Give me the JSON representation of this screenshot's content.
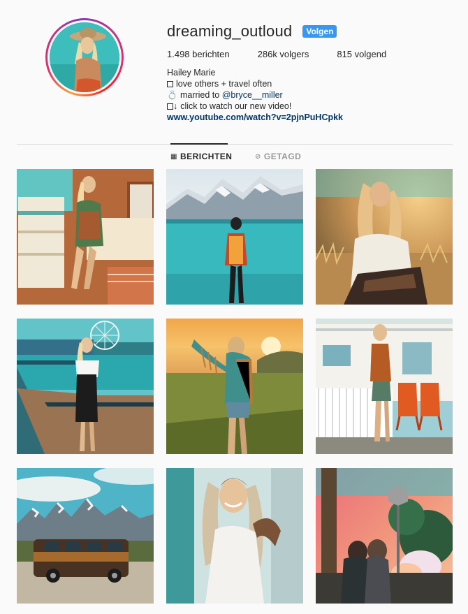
{
  "profile": {
    "username": "dreaming_outloud",
    "follow_label": "Volgen",
    "stats": {
      "posts": "1.498 berichten",
      "followers": "286k volgers",
      "following": "815 volgend"
    },
    "bio": {
      "name": "Hailey Marie",
      "line1": "love others + travel often",
      "line2_prefix": "married to ",
      "line2_mention": "@bryce__miller",
      "line3": "click to watch our new video!",
      "link": "www.youtube.com/watch?v=2pjnPuHCpkk"
    }
  },
  "tabs": {
    "posts": "BERICHTEN",
    "tagged": "GETAGD"
  },
  "icons": {
    "posts_tab": "grid-icon",
    "tagged_tab": "tag-icon",
    "ring": "ring-icon",
    "arrow": "arrow-down-icon"
  },
  "colors": {
    "accent": "#3897f0",
    "link": "#003569",
    "divider": "#dbdbdb",
    "background": "#fafafa"
  },
  "posts": [
    {
      "subject": "woman sitting in retro camper kitchen"
    },
    {
      "subject": "man standing in turquoise lake with snowy mountains"
    },
    {
      "subject": "smiling woman in golden field"
    },
    {
      "subject": "woman on pier with ferris wheel"
    },
    {
      "subject": "woman with fringe jacket at sunset"
    },
    {
      "subject": "woman by white trailer with orange chairs"
    },
    {
      "subject": "vintage van in front of mountains"
    },
    {
      "subject": "smiling woman with hat"
    },
    {
      "subject": "couple by stop sign with colorful smoke"
    }
  ]
}
